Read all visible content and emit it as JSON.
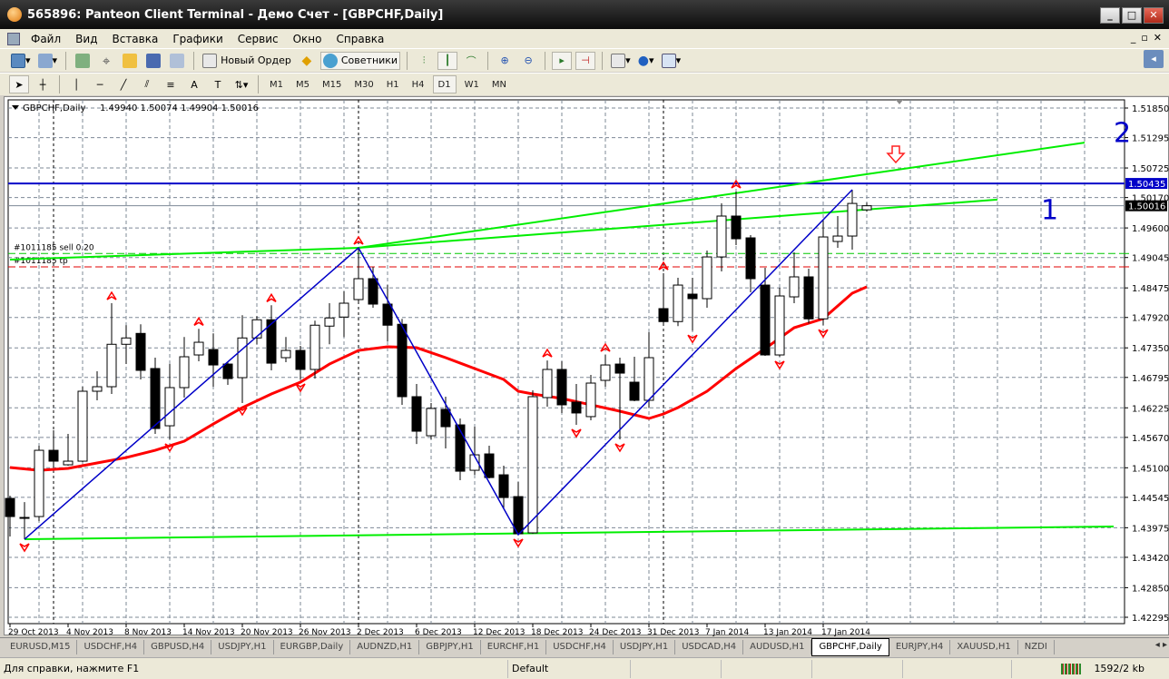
{
  "window": {
    "title": "565896: Panteon Client Terminal - Демо Счет - [GBPCHF,Daily]",
    "controls": [
      "_",
      "□",
      "✕"
    ]
  },
  "menu": [
    "Файл",
    "Вид",
    "Вставка",
    "Графики",
    "Сервис",
    "Окно",
    "Справка"
  ],
  "mdi_controls": [
    "_",
    "▫",
    "✕"
  ],
  "toolbar1": {
    "new_order": "Новый Ордер",
    "experts": "Советники"
  },
  "timeframes": [
    "M1",
    "M5",
    "M15",
    "M30",
    "H1",
    "H4",
    "D1",
    "W1",
    "MN"
  ],
  "active_timeframe": "D1",
  "tabs": [
    "EURUSD,M15",
    "USDCHF,H4",
    "GBPUSD,H4",
    "USDJPY,H1",
    "EURGBP,Daily",
    "AUDNZD,H1",
    "GBPJPY,H1",
    "EURCHF,H1",
    "USDCHF,H4",
    "USDJPY,H1",
    "USDCAD,H4",
    "AUDUSD,H1",
    "GBPCHF,Daily",
    "EURJPY,H4",
    "XAUUSD,H1",
    "NZDI"
  ],
  "active_tab": "GBPCHF,Daily",
  "status": {
    "help": "Для справки, нажмите F1",
    "profile": "Default",
    "traffic": "1592/2 kb"
  },
  "chart_data": {
    "type": "candlestick",
    "symbol_header": "GBPCHF,Daily",
    "ohlc_header": "1.49940 1.50074 1.49904 1.50016",
    "order_labels": [
      "#1011185 sell 0.20",
      "#1011185 tp"
    ],
    "order_levels": {
      "sell": 1.4912,
      "tp": 1.4887
    },
    "ylim": [
      1.42295,
      1.5185
    ],
    "y_ticks": [
      "1.51850",
      "1.51295",
      "1.50725",
      "1.50170",
      "1.49600",
      "1.49045",
      "1.48475",
      "1.47920",
      "1.47350",
      "1.46795",
      "1.46225",
      "1.45670",
      "1.45100",
      "1.44545",
      "1.43975",
      "1.43420",
      "1.42850",
      "1.42295"
    ],
    "x_ticks": [
      {
        "label": "29 Oct 2013",
        "bar": 0
      },
      {
        "label": "4 Nov 2013",
        "bar": 4
      },
      {
        "label": "8 Nov 2013",
        "bar": 8
      },
      {
        "label": "14 Nov 2013",
        "bar": 12
      },
      {
        "label": "20 Nov 2013",
        "bar": 16
      },
      {
        "label": "26 Nov 2013",
        "bar": 20
      },
      {
        "label": "2 Dec 2013",
        "bar": 24
      },
      {
        "label": "6 Dec 2013",
        "bar": 28
      },
      {
        "label": "12 Dec 2013",
        "bar": 32
      },
      {
        "label": "18 Dec 2013",
        "bar": 36
      },
      {
        "label": "24 Dec 2013",
        "bar": 40
      },
      {
        "label": "31 Dec 2013",
        "bar": 44
      },
      {
        "label": "7 Jan 2014",
        "bar": 48
      },
      {
        "label": "13 Jan 2014",
        "bar": 52
      },
      {
        "label": "17 Jan 2014",
        "bar": 56
      }
    ],
    "candles": [
      [
        1.44525,
        1.44576,
        1.4381,
        1.44185
      ],
      [
        1.44168,
        1.44457,
        1.43759,
        1.44151
      ],
      [
        1.44185,
        1.45513,
        1.441,
        1.45428
      ],
      [
        1.45428,
        1.45803,
        1.45122,
        1.45224
      ],
      [
        1.45156,
        1.45735,
        1.45139,
        1.45224
      ],
      [
        1.45224,
        1.46621,
        1.45207,
        1.46536
      ],
      [
        1.46536,
        1.4691,
        1.46366,
        1.46621
      ],
      [
        1.46621,
        1.48188,
        1.46485,
        1.47417
      ],
      [
        1.47417,
        1.47775,
        1.47046,
        1.47536
      ],
      [
        1.47621,
        1.47792,
        1.46757,
        1.46928
      ],
      [
        1.46962,
        1.47166,
        1.45735,
        1.45837
      ],
      [
        1.45888,
        1.47046,
        1.45633,
        1.46604
      ],
      [
        1.46604,
        1.47553,
        1.46417,
        1.47183
      ],
      [
        1.47217,
        1.47706,
        1.47098,
        1.47455
      ],
      [
        1.47319,
        1.47621,
        1.46621,
        1.47029
      ],
      [
        1.47046,
        1.47098,
        1.46655,
        1.46774
      ],
      [
        1.46791,
        1.47962,
        1.46315,
        1.47536
      ],
      [
        1.47536,
        1.47945,
        1.47417,
        1.47877
      ],
      [
        1.47877,
        1.48149,
        1.46928,
        1.47063
      ],
      [
        1.47166,
        1.47553,
        1.4708,
        1.47302
      ],
      [
        1.47302,
        1.47387,
        1.46757,
        1.46945
      ],
      [
        1.46945,
        1.4786,
        1.46774,
        1.47775
      ],
      [
        1.47758,
        1.48188,
        1.47417,
        1.47911
      ],
      [
        1.47928,
        1.4841,
        1.47553,
        1.48188
      ],
      [
        1.48256,
        1.49227,
        1.48188,
        1.48648
      ],
      [
        1.48648,
        1.48869,
        1.48103,
        1.48171
      ],
      [
        1.48171,
        1.48529,
        1.47472,
        1.47775
      ],
      [
        1.47792,
        1.47894,
        1.46281,
        1.46434
      ],
      [
        1.46434,
        1.46672,
        1.45547,
        1.45786
      ],
      [
        1.45701,
        1.46315,
        1.45633,
        1.46213
      ],
      [
        1.46196,
        1.46434,
        1.45462,
        1.45871
      ],
      [
        1.45905,
        1.46025,
        1.44867,
        1.45036
      ],
      [
        1.45053,
        1.45871,
        1.44968,
        1.45343
      ],
      [
        1.4536,
        1.45513,
        1.449,
        1.44917
      ],
      [
        1.44968,
        1.45139,
        1.44321,
        1.44542
      ],
      [
        1.44559,
        1.44832,
        1.43845,
        1.43862
      ],
      [
        1.43879,
        1.46553,
        1.43862,
        1.46434
      ],
      [
        1.46417,
        1.47114,
        1.46247,
        1.46945
      ],
      [
        1.46945,
        1.47098,
        1.46128,
        1.46281
      ],
      [
        1.46332,
        1.46672,
        1.45905,
        1.46128
      ],
      [
        1.4606,
        1.46842,
        1.45991,
        1.46689
      ],
      [
        1.4674,
        1.47217,
        1.46621,
        1.47029
      ],
      [
        1.47046,
        1.47166,
        1.45633,
        1.46876
      ],
      [
        1.46706,
        1.47183,
        1.46349,
        1.46366
      ],
      [
        1.46366,
        1.47643,
        1.4623,
        1.47166
      ],
      [
        1.48086,
        1.4875,
        1.47809,
        1.47843
      ],
      [
        1.47843,
        1.48665,
        1.47758,
        1.48528
      ],
      [
        1.48358,
        1.48665,
        1.47673,
        1.48273
      ],
      [
        1.48273,
        1.49176,
        1.48103,
        1.49056
      ],
      [
        1.49056,
        1.50061,
        1.48784,
        1.49823
      ],
      [
        1.49823,
        1.50283,
        1.49278,
        1.49397
      ],
      [
        1.49414,
        1.49465,
        1.48392,
        1.48648
      ],
      [
        1.48528,
        1.48852,
        1.472,
        1.47217
      ],
      [
        1.47217,
        1.48477,
        1.47183,
        1.48324
      ],
      [
        1.48307,
        1.49142,
        1.48188,
        1.48682
      ],
      [
        1.48682,
        1.48835,
        1.47809,
        1.47894
      ],
      [
        1.47894,
        1.49754,
        1.47775,
        1.49431
      ],
      [
        1.49346,
        1.49823,
        1.49227,
        1.49448
      ],
      [
        1.49448,
        1.50317,
        1.49193,
        1.5006
      ],
      [
        1.4994,
        1.50074,
        1.49904,
        1.50016
      ]
    ],
    "moving_average": [
      [
        0,
        1.45105
      ],
      [
        2,
        1.45053
      ],
      [
        4,
        1.45088
      ],
      [
        6,
        1.4519
      ],
      [
        8,
        1.45292
      ],
      [
        10,
        1.45428
      ],
      [
        12,
        1.45599
      ],
      [
        14,
        1.45922
      ],
      [
        16,
        1.46229
      ],
      [
        18,
        1.46485
      ],
      [
        20,
        1.46706
      ],
      [
        22,
        1.47046
      ],
      [
        24,
        1.47302
      ],
      [
        26,
        1.4737
      ],
      [
        28,
        1.47353
      ],
      [
        30,
        1.47166
      ],
      [
        32,
        1.46962
      ],
      [
        34,
        1.46757
      ],
      [
        35,
        1.46536
      ],
      [
        36,
        1.46485
      ],
      [
        38,
        1.464
      ],
      [
        40,
        1.46281
      ],
      [
        42,
        1.46161
      ],
      [
        44,
        1.46025
      ],
      [
        45,
        1.4611
      ],
      [
        46,
        1.46229
      ],
      [
        48,
        1.46536
      ],
      [
        50,
        1.46962
      ],
      [
        52,
        1.47336
      ],
      [
        54,
        1.47728
      ],
      [
        56,
        1.47898
      ],
      [
        58,
        1.48375
      ],
      [
        59,
        1.48494
      ]
    ],
    "zigzag": [
      [
        1,
        1.43759
      ],
      [
        24,
        1.49227
      ],
      [
        35,
        1.43845
      ],
      [
        58,
        1.50317
      ]
    ],
    "fractals_up": [
      7,
      13,
      18,
      24,
      37,
      41,
      45,
      50
    ],
    "fractals_down": [
      1,
      11,
      16,
      20,
      35,
      39,
      42,
      47,
      53,
      56
    ],
    "resistance_level": {
      "value": 1.50435,
      "label": "1.50435"
    },
    "current_price": {
      "value": 1.50016,
      "label": "1.50016"
    },
    "trendlines": [
      {
        "name": "base",
        "points": [
          [
            0,
            1.49006
          ],
          [
            24,
            1.49227
          ]
        ]
      },
      {
        "name": "line-2",
        "points": [
          [
            24,
            1.49227
          ],
          [
            74,
            1.51201
          ]
        ]
      },
      {
        "name": "line-1",
        "points": [
          [
            24,
            1.49227
          ],
          [
            68,
            1.50131
          ]
        ]
      },
      {
        "name": "support",
        "points": [
          [
            1,
            1.43759
          ],
          [
            76,
            1.43998
          ]
        ]
      }
    ],
    "annotations": [
      {
        "text": "1",
        "bar": 71,
        "price": 1.49969
      },
      {
        "text": "2",
        "bar": 76,
        "price": 1.51415
      }
    ],
    "sell_arrow": {
      "bar": 61,
      "price": 1.5093
    },
    "separators": [
      3,
      24,
      45
    ],
    "colors": {
      "bull": "#ffffff",
      "bear": "#000000",
      "ma": "#ff0000",
      "zigzag": "#0000c8",
      "trend": "#00ee00",
      "level": "#0000c8",
      "fractal": "#ff0000"
    }
  }
}
